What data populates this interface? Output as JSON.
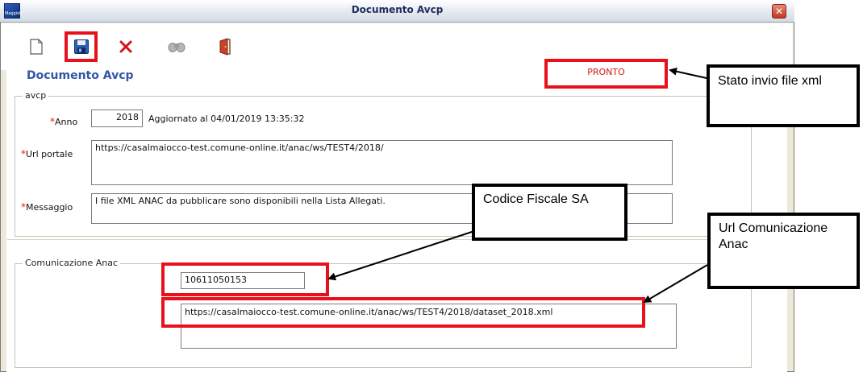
{
  "window": {
    "title": "Documento Avcp",
    "app_icon_text": "Maggioli"
  },
  "toolbar": {
    "buttons": [
      {
        "icon": "new-document-icon"
      },
      {
        "icon": "save-icon"
      },
      {
        "icon": "delete-icon"
      },
      {
        "icon": "binoculars-icon"
      },
      {
        "icon": "exit-door-icon"
      }
    ]
  },
  "page": {
    "heading": "Documento Avcp",
    "status": "PRONTO"
  },
  "avcp": {
    "group_label": "avcp",
    "anno_label": "Anno",
    "anno_value": "2018",
    "aggiornato": "Aggiornato al 04/01/2019 13:35:32",
    "url_label": "Url portale",
    "url_value": "https://casalmaiocco-test.comune-online.it/anac/ws/TEST4/2018/",
    "msg_label": "Messaggio",
    "msg_value": "I file XML ANAC da pubblicare sono disponibili nella Lista Allegati.",
    "required_mark": "*"
  },
  "comunicazione": {
    "group_label": "Comunicazione Anac",
    "codice_fiscale": "10611050153",
    "url": "https://casalmaiocco-test.comune-online.it/anac/ws/TEST4/2018/dataset_2018.xml"
  },
  "callouts": {
    "stato": "Stato invio file xml",
    "codice": "Codice Fiscale SA",
    "url": "Url Comunicazione Anac"
  },
  "colors": {
    "highlight": "#e8111b",
    "heading": "#3357a8",
    "status": "#d21818"
  }
}
